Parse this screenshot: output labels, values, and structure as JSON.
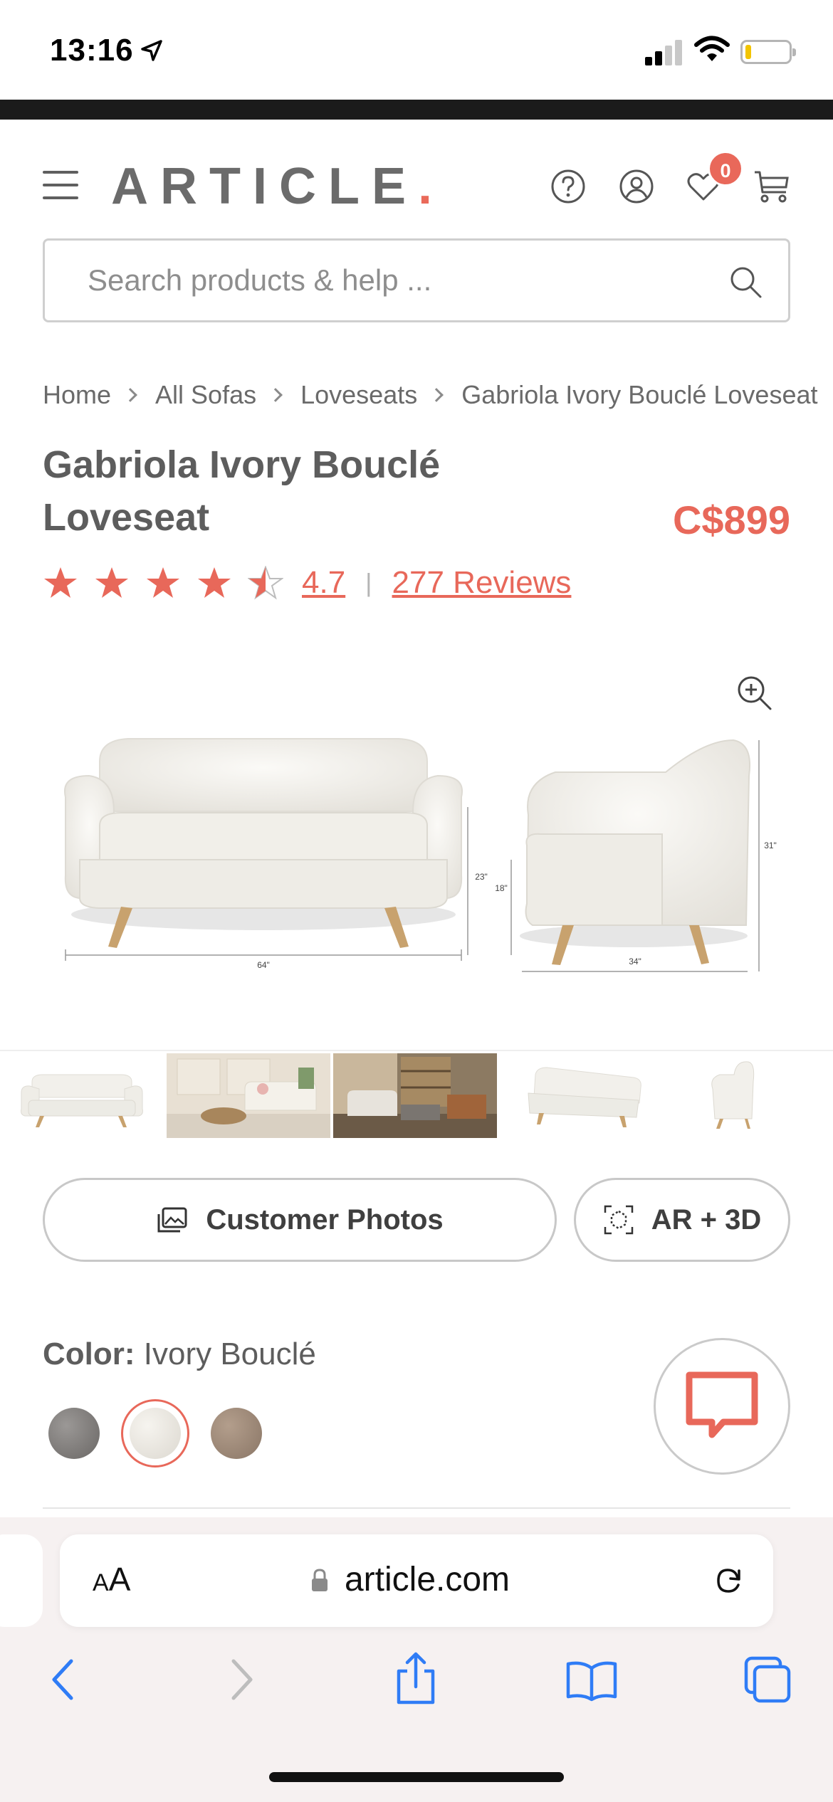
{
  "status_bar": {
    "time": "13:16",
    "icons": [
      "location-arrow-icon",
      "signal-icon",
      "wifi-icon",
      "battery-icon"
    ]
  },
  "header": {
    "logo_text": "ARTICLE",
    "logo_dot": ".",
    "wishlist_count": "0",
    "icons": [
      "menu-icon",
      "help-icon",
      "account-icon",
      "heart-icon",
      "cart-icon"
    ]
  },
  "search": {
    "placeholder": "Search products & help ..."
  },
  "breadcrumb": [
    "Home",
    "All Sofas",
    "Loveseats",
    "Gabriola Ivory Bouclé Loveseat"
  ],
  "product": {
    "title_line1": "Gabriola Ivory Bouclé",
    "title_line2": "Loveseat",
    "price": "C$899",
    "rating": "4.7",
    "rating_fraction": 0.94,
    "reviews": "277 Reviews"
  },
  "dimensions": {
    "front_width": "64\"",
    "back_height": "23\"",
    "seat_height": "18\"",
    "side_height": "31\"",
    "depth": "34\""
  },
  "thumbnails": [
    "front-view",
    "living-room-scene",
    "lounge-scene",
    "angled-view",
    "side-view"
  ],
  "buttons": {
    "customer_photos": "Customer Photos",
    "ar3d": "AR + 3D"
  },
  "color": {
    "label": "Color:",
    "value": "Ivory Bouclé",
    "swatches": [
      "#7c7a78",
      "#e9e6e0",
      "#9b8776"
    ],
    "selected_index": 1
  },
  "safari": {
    "text_size": "AA",
    "url": "article.com"
  },
  "colors": {
    "accent": "#e8685a",
    "text": "#5d5d5d",
    "safari_blue": "#3b82f6"
  }
}
